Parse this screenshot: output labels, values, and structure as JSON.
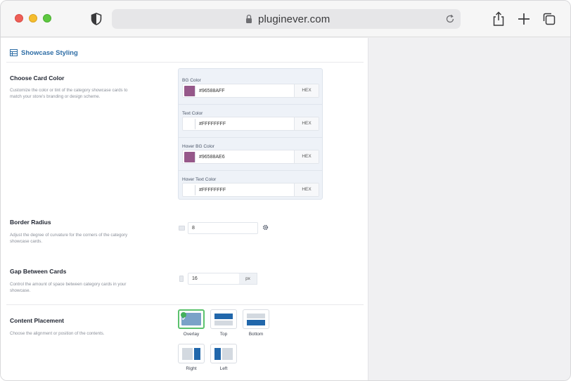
{
  "browser": {
    "url": "pluginever.com"
  },
  "section": {
    "title": "Showcase Styling"
  },
  "card_color": {
    "label": "Choose Card Color",
    "description": "Customize the color or tint of the category showcase cards to match your store's branding or design scheme.",
    "fields": [
      {
        "label": "BG Color",
        "value": "#96588AFF",
        "swatch": "#96588a",
        "format": "HEX"
      },
      {
        "label": "Text Color",
        "value": "#FFFFFFFF",
        "swatch": "#ffffff",
        "format": "HEX"
      },
      {
        "label": "Hover BG Color",
        "value": "#96588AE6",
        "swatch": "#96588a",
        "format": "HEX"
      },
      {
        "label": "Hover Text Color",
        "value": "#FFFFFFFF",
        "swatch": "#ffffff",
        "format": "HEX"
      }
    ]
  },
  "border_radius": {
    "label": "Border Radius",
    "description": "Adjust the degree of curvature for the corners of the category showcase cards.",
    "value": "8"
  },
  "gap": {
    "label": "Gap Between Cards",
    "description": "Control the amount of space between category cards in your showcase.",
    "value": "16",
    "unit": "px"
  },
  "placement": {
    "label": "Content Placement",
    "description": "Choose the alignment or position of the contents.",
    "options": [
      "Overlay",
      "Top",
      "Bottom",
      "Right",
      "Left"
    ],
    "selected": "Overlay"
  },
  "colors": {
    "accent_blue": "#2f6ea6",
    "selected_green": "#5cc26e",
    "swatch_purple": "#96588a"
  }
}
